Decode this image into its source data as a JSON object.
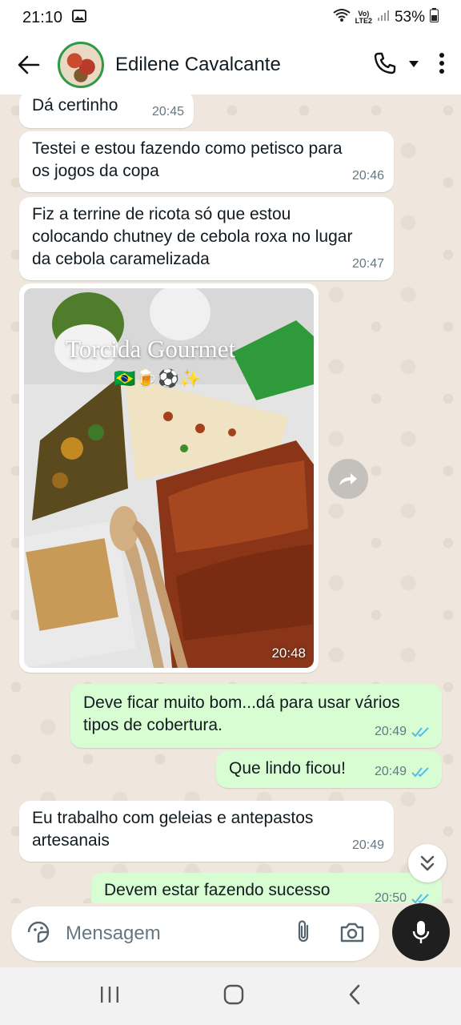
{
  "status_bar": {
    "time": "21:10",
    "volte_line1": "Vo)",
    "volte_line2": "LTE2",
    "battery": "53%"
  },
  "header": {
    "contact_name": "Edilene Cavalcante"
  },
  "messages": [
    {
      "text": "Dá certinho",
      "time": "20:45"
    },
    {
      "text": "Testei e estou fazendo como petisco para os jogos da copa",
      "time": "20:46"
    },
    {
      "text": "Fiz a terrine de ricota só que estou colocando chutney de cebola roxa no lugar da cebola caramelizada",
      "time": "20:47"
    },
    {
      "image_caption": "Torcida Gourmet",
      "image_emojis": "🇧🇷🍺⚽✨",
      "time": "20:48"
    },
    {
      "text": "Deve ficar muito bom...dá para usar vários tipos de cobertura.",
      "time": "20:49"
    },
    {
      "text": "Que lindo ficou!",
      "time": "20:49"
    },
    {
      "text": "Eu trabalho com geleias e antepastos artesanais",
      "time": "20:49"
    },
    {
      "text": "Devem estar fazendo sucesso",
      "time": "20:50"
    }
  ],
  "composer": {
    "placeholder": "Mensagem"
  },
  "colors": {
    "outgoing": "#d9fdd3",
    "incoming": "#ffffff",
    "read_tick": "#53bdeb",
    "accent": "#1f1f1f"
  }
}
